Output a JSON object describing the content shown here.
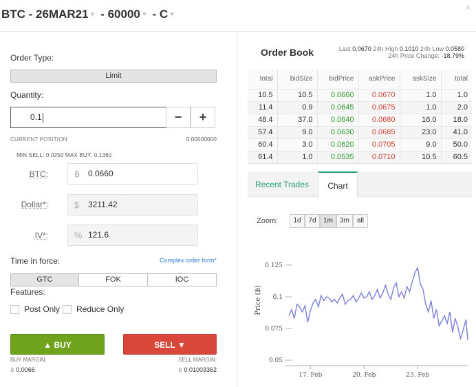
{
  "header": {
    "instrument_parts": [
      "BTC - 26MAR21",
      " - 60000",
      " - C"
    ],
    "close_label": "×"
  },
  "order_form": {
    "order_type_label": "Order Type:",
    "order_type_value": "Limit",
    "quantity_label": "Quantity:",
    "quantity_value": "0.1",
    "minus_label": "−",
    "plus_label": "+",
    "current_position_label": "CURRENT POSITION:",
    "current_position_value": "0.00000000",
    "min_sell_label": "MIN SELL:",
    "min_sell_value": "0.0250",
    "max_buy_label": "MAX BUY:",
    "max_buy_value": "0.1360",
    "btc_label": "BTC:",
    "btc_symbol": "฿",
    "btc_value": "0.0660",
    "dollar_label": "Dollar*:",
    "dollar_symbol": "$",
    "dollar_value": "3211.42",
    "iv_label": "IV*:",
    "iv_symbol": "%",
    "iv_value": "121.6",
    "time_in_force_label": "Time in force:",
    "complex_order_link": "Complex order form*",
    "tif_options": [
      "GTC",
      "FOK",
      "IOC"
    ],
    "tif_selected": "GTC",
    "features_label": "Features:",
    "post_only_label": "Post Only",
    "reduce_only_label": "Reduce Only",
    "buy_label": "BUY",
    "sell_label": "SELL",
    "buy_margin_label": "BUY MARGIN:",
    "buy_margin_value": "0.0066",
    "sell_margin_label": "SELL MARGIN:",
    "sell_margin_value": "0.01003362",
    "currency_symbol": "฿"
  },
  "order_book": {
    "title": "Order Book",
    "last_label": "Last",
    "last_value": "0.0670",
    "high_label": "24h High",
    "high_value": "0.1010",
    "low_label": "24h Low",
    "low_value": "0.0580",
    "change_label": "24h Price Change:",
    "change_value": "-18.79%",
    "columns": [
      "total",
      "bidSize",
      "bidPrice",
      "askPrice",
      "askSize",
      "total"
    ],
    "rows": [
      [
        "10.5",
        "10.5",
        "0.0660",
        "0.0670",
        "1.0",
        "1.0"
      ],
      [
        "11.4",
        "0.9",
        "0.0645",
        "0.0675",
        "1.0",
        "2.0"
      ],
      [
        "48.4",
        "37.0",
        "0.0640",
        "0.0680",
        "16.0",
        "18.0"
      ],
      [
        "57.4",
        "9.0",
        "0.0630",
        "0.0685",
        "23.0",
        "41.0"
      ],
      [
        "60.4",
        "3.0",
        "0.0620",
        "0.0705",
        "9.0",
        "50.0"
      ],
      [
        "61.4",
        "1.0",
        "0.0535",
        "0.0710",
        "10.5",
        "60.5"
      ]
    ]
  },
  "tabs": {
    "recent_trades": "Recent Trades",
    "chart": "Chart",
    "active": "Chart"
  },
  "chart_controls": {
    "zoom_label": "Zoom:",
    "zoom_options": [
      "1d",
      "7d",
      "1m",
      "3m",
      "all"
    ],
    "zoom_selected": "1m"
  },
  "chart_data": {
    "type": "line",
    "title": "",
    "ylabel": "Price (฿)",
    "xlabel": "",
    "ylim": [
      0.05,
      0.13
    ],
    "yticks": [
      "0.125",
      "0.1",
      "0.075",
      "0.05"
    ],
    "ytick_values": [
      0.125,
      0.1,
      0.075,
      0.05
    ],
    "xticks": [
      "17. Feb",
      "20. Feb",
      "23. Feb"
    ],
    "xtick_days": [
      17,
      20,
      23
    ],
    "xlim_days": [
      15.8,
      25.8
    ],
    "line_color": "#7b7fdc",
    "series": [
      {
        "x_days": [
          15.8,
          15.95,
          16.1,
          16.25,
          16.4,
          16.55,
          16.7,
          16.85,
          17.0,
          17.15,
          17.3,
          17.45,
          17.6,
          17.75,
          17.9,
          18.05,
          18.2,
          18.35,
          18.5,
          18.65,
          18.8,
          18.95,
          19.1,
          19.25,
          19.4,
          19.55,
          19.7,
          19.85,
          20.0,
          20.15,
          20.3,
          20.45,
          20.6,
          20.75,
          20.9,
          21.05,
          21.2,
          21.35,
          21.5,
          21.65,
          21.8,
          21.95,
          22.1,
          22.25,
          22.4,
          22.55,
          22.7,
          22.85,
          23.0,
          23.15,
          23.3,
          23.45,
          23.6,
          23.75,
          23.9,
          24.05,
          24.2,
          24.35,
          24.5,
          24.65,
          24.8,
          24.95,
          25.1,
          25.25,
          25.4,
          25.55,
          25.7,
          25.8
        ],
        "values": [
          0.085,
          0.09,
          0.083,
          0.094,
          0.092,
          0.088,
          0.093,
          0.08,
          0.089,
          0.095,
          0.098,
          0.092,
          0.101,
          0.097,
          0.1,
          0.099,
          0.096,
          0.098,
          0.095,
          0.099,
          0.102,
          0.094,
          0.097,
          0.098,
          0.101,
          0.096,
          0.099,
          0.103,
          0.099,
          0.1,
          0.104,
          0.098,
          0.101,
          0.106,
          0.099,
          0.103,
          0.109,
          0.102,
          0.098,
          0.107,
          0.111,
          0.1,
          0.104,
          0.099,
          0.108,
          0.104,
          0.112,
          0.119,
          0.123,
          0.11,
          0.106,
          0.094,
          0.088,
          0.097,
          0.083,
          0.09,
          0.077,
          0.081,
          0.085,
          0.079,
          0.088,
          0.072,
          0.083,
          0.076,
          0.067,
          0.074,
          0.082,
          0.066
        ]
      }
    ]
  }
}
